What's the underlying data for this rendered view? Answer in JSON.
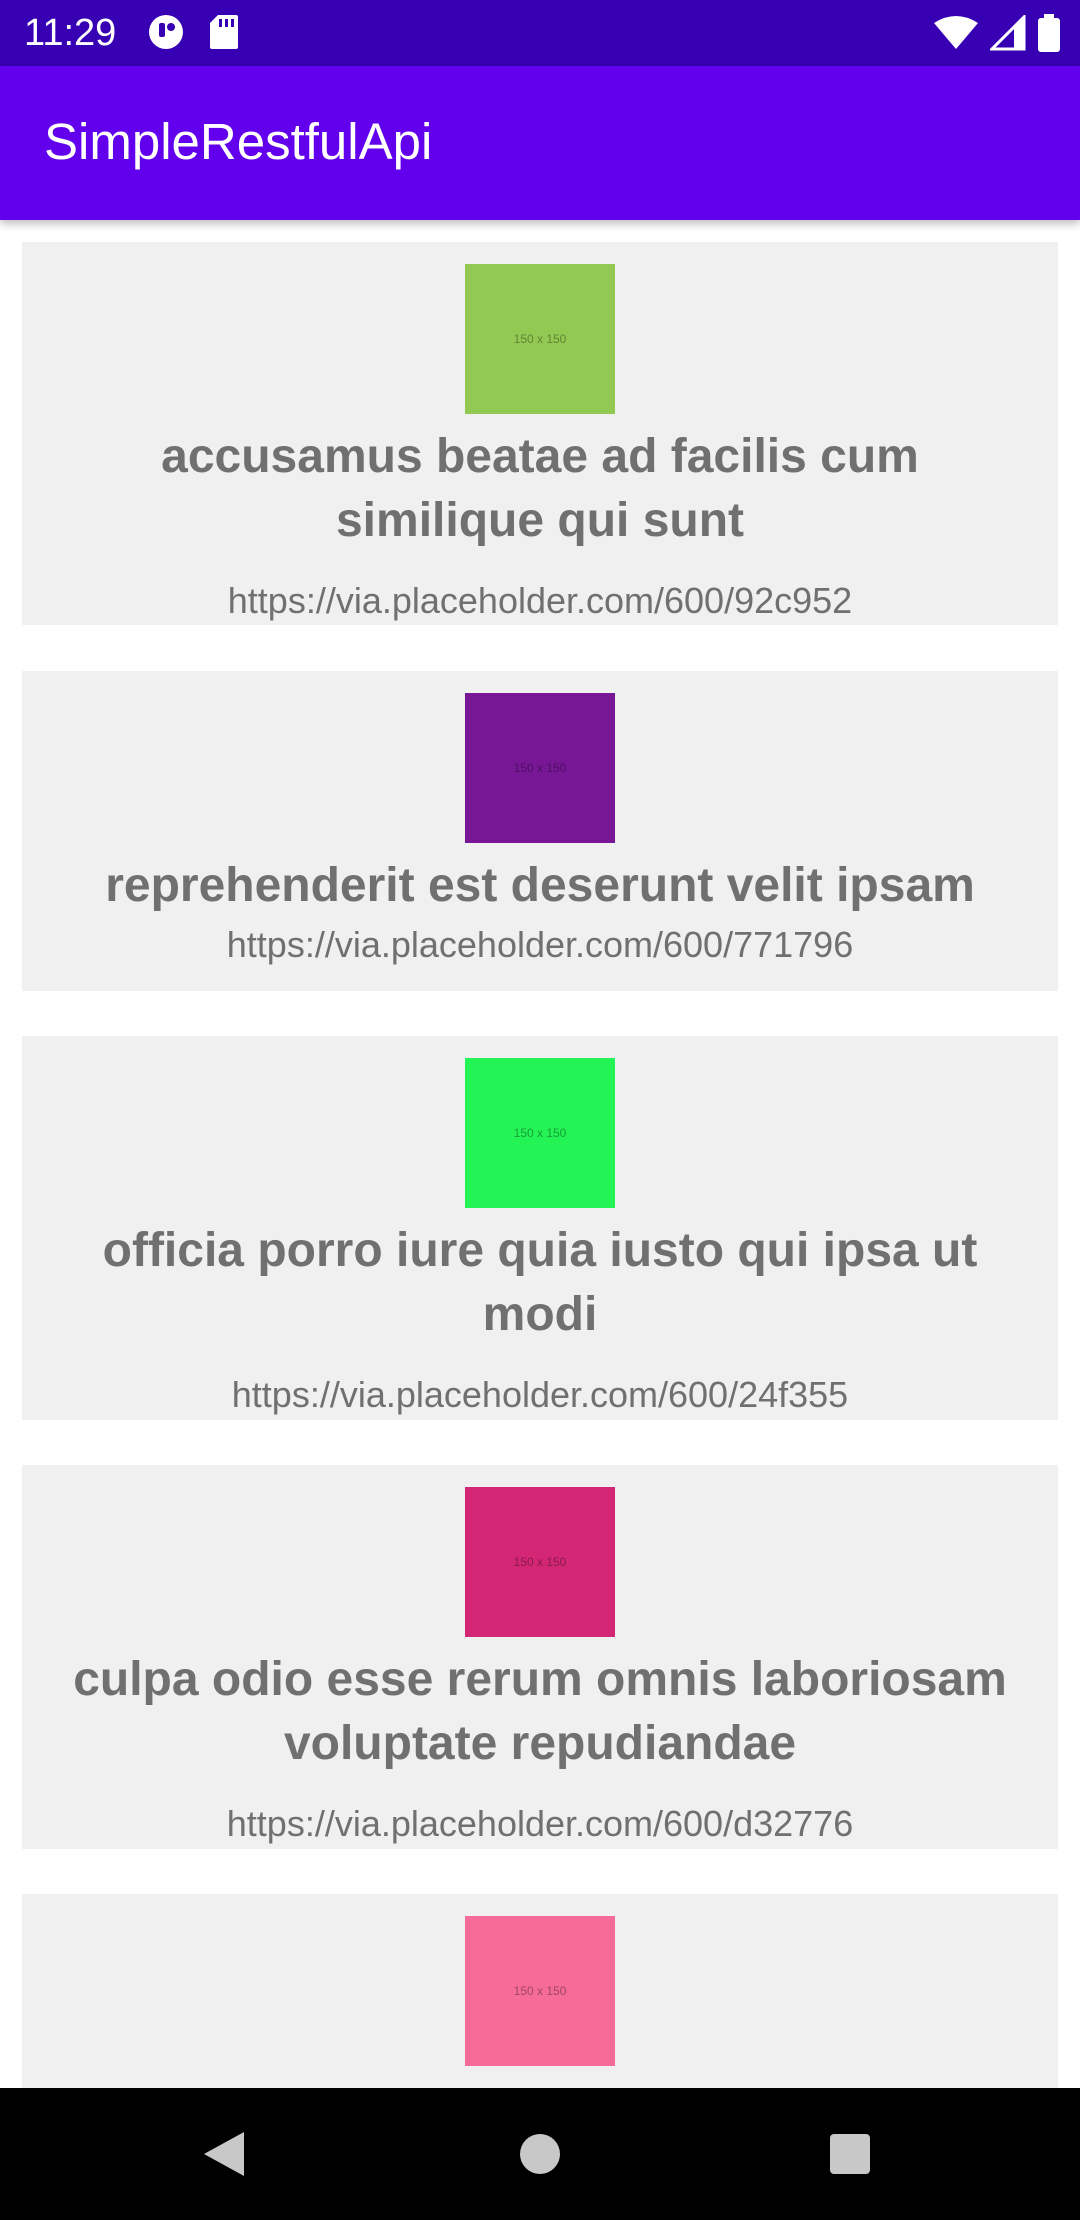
{
  "status_bar": {
    "time": "11:29",
    "icons": [
      "app-notification-icon",
      "sd-card-icon",
      "wifi-icon",
      "signal-icon",
      "battery-icon"
    ]
  },
  "app_bar": {
    "title": "SimpleRestfulApi"
  },
  "items": [
    {
      "image_label": "150 x 150",
      "image_color": "#92c952",
      "title": "accusamus beatae ad facilis cum similique qui sunt",
      "url": "https://via.placeholder.com/600/92c952"
    },
    {
      "image_label": "150 x 150",
      "image_color": "#771796",
      "title": "reprehenderit est deserunt velit ipsam",
      "url": "https://via.placeholder.com/600/771796"
    },
    {
      "image_label": "150 x 150",
      "image_color": "#24f355",
      "title": "officia porro iure quia iusto qui ipsa ut modi",
      "url": "https://via.placeholder.com/600/24f355"
    },
    {
      "image_label": "150 x 150",
      "image_color": "#d32776",
      "title": "culpa odio esse rerum omnis laboriosam voluptate repudiandae",
      "url": "https://via.placeholder.com/600/d32776"
    },
    {
      "image_label": "150 x 150",
      "image_color": "#f66b97",
      "title": "",
      "url": ""
    }
  ],
  "nav_bar": {
    "icons": [
      "back-icon",
      "home-icon",
      "recents-icon"
    ]
  },
  "colors": {
    "status_bar": "#3700b3",
    "app_bar": "#6200ee",
    "card_background": "#f0f0f0",
    "text": "#707070"
  }
}
